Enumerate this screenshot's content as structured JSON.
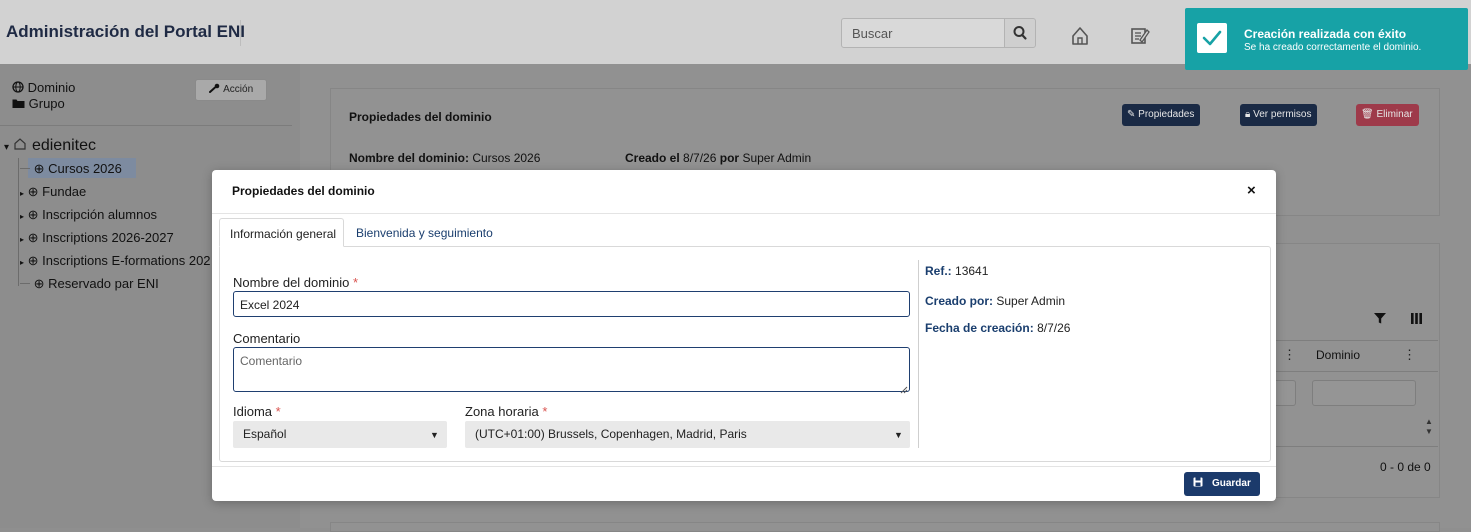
{
  "header": {
    "app_title": "Administración del Portal ENI",
    "search_placeholder": "Buscar"
  },
  "toast": {
    "title": "Creación realizada con éxito",
    "message": "Se ha creado correctamente el dominio."
  },
  "sidebar": {
    "link_dominio": "Dominio",
    "link_grupo": "Grupo",
    "accion_label": "Acción",
    "tree_root": "edienitec",
    "tree_items": [
      "Cursos 2026",
      "Fundae",
      "Inscripción alumnos",
      "Inscriptions 2026-2027",
      "Inscriptions E-formations 202",
      "Reservado par ENI"
    ]
  },
  "background_card": {
    "title": "Propiedades del dominio",
    "btn_propiedades": "Propiedades",
    "btn_permisos": "Ver permisos",
    "btn_eliminar": "Eliminar",
    "nombre_label": "Nombre del dominio:",
    "nombre_value": "Cursos 2026",
    "creado_label": "Creado el",
    "creado_date": "8/7/26",
    "creado_por_label": "por",
    "creado_por_value": "Super Admin"
  },
  "background_table": {
    "col_dominio": "Dominio",
    "pager": "0 - 0 de 0"
  },
  "modal": {
    "title": "Propiedades del dominio",
    "tabs": [
      "Información general",
      "Bienvenida y seguimiento"
    ],
    "nombre_label": "Nombre del dominio",
    "nombre_value": "Excel 2024",
    "comentario_label": "Comentario",
    "comentario_placeholder": "Comentario",
    "idioma_label": "Idioma",
    "idioma_value": "Español",
    "zona_label": "Zona horaria",
    "zona_value": "(UTC+01:00) Brussels, Copenhagen, Madrid, Paris",
    "ref_label": "Ref.:",
    "ref_value": "13641",
    "creado_por_label": "Creado por:",
    "creado_por_value": "Super Admin",
    "fecha_label": "Fecha de creación:",
    "fecha_value": "8/7/26",
    "guardar_label": "Guardar"
  },
  "colors": {
    "primary": "#1b3a6b",
    "toast": "#17a2a6",
    "danger": "#d9534f"
  }
}
